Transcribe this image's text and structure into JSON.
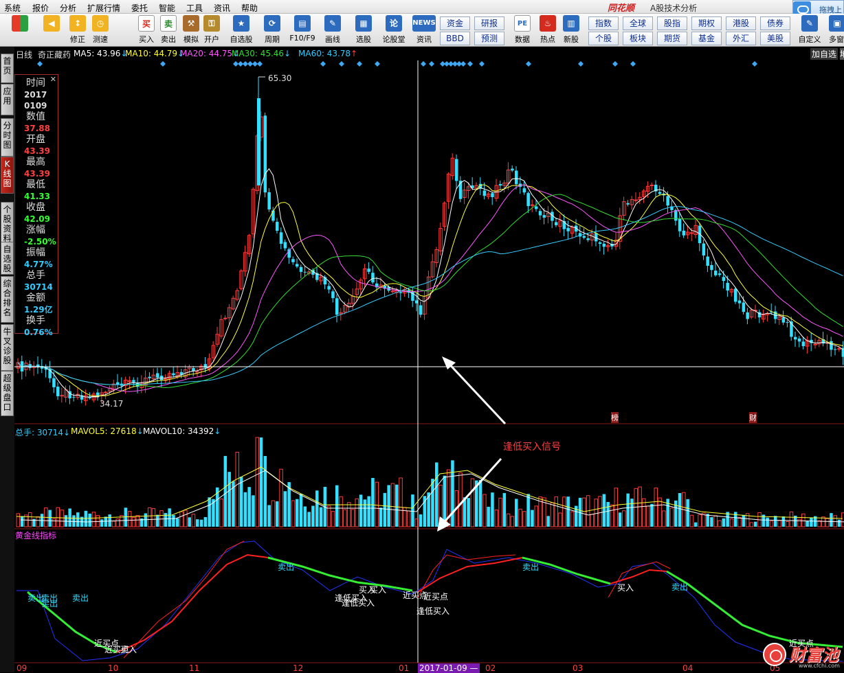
{
  "menu": [
    "系统",
    "报价",
    "分析",
    "扩展行情",
    "委托",
    "智能",
    "工具",
    "资讯",
    "帮助"
  ],
  "brand": {
    "logo": "同花顺",
    "sub": "A股技术分析",
    "drag": "拖拽上"
  },
  "toolbar": {
    "items": [
      {
        "label": "",
        "icon": "colored-squares-icon",
        "color": "#e43b2a"
      },
      {
        "label": "",
        "icon": "back-arrow-icon",
        "color": "#f1b321"
      },
      {
        "label": "修正",
        "icon": "up-down-arrow-icon",
        "color": "#f1b321"
      },
      {
        "label": "测速",
        "icon": "clock-icon",
        "color": "#f1b321"
      },
      {
        "label": "买入",
        "icon": "buy-icon",
        "color": "#d52a1e",
        "glyph": "买"
      },
      {
        "label": "卖出",
        "icon": "sell-icon",
        "color": "#2a8a2a",
        "glyph": "卖"
      },
      {
        "label": "模拟",
        "icon": "hammer-icon",
        "color": "#a86b2c"
      },
      {
        "label": "开户",
        "icon": "lock-icon",
        "color": "#b58a2c"
      },
      {
        "label": "自选股",
        "icon": "star-icon",
        "color": "#2d6bbf"
      },
      {
        "label": "周期",
        "icon": "cycle-icon",
        "color": "#2d6bbf"
      },
      {
        "label": "F10/F9",
        "icon": "f10-icon",
        "color": "#2d6bbf"
      },
      {
        "label": "画线",
        "icon": "pen-icon",
        "color": "#2d6bbf"
      },
      {
        "label": "选股",
        "icon": "screen-icon",
        "color": "#2d6bbf"
      },
      {
        "label": "论股堂",
        "icon": "forum-icon",
        "color": "#2d6bbf"
      },
      {
        "label": "资讯",
        "icon": "news-icon",
        "color": "#2d6bbf",
        "glyph": "NEWS"
      },
      {
        "label": "数据",
        "icon": "data-icon",
        "color": "#2d6bbf",
        "glyph": "PE"
      },
      {
        "label": "热点",
        "icon": "hot-icon",
        "color": "#d52a1e"
      },
      {
        "label": "新股",
        "icon": "new-stock-icon",
        "color": "#2d6bbf"
      },
      {
        "label": "自定义",
        "icon": "custom-icon",
        "color": "#2d6bbf"
      },
      {
        "label": "多窗",
        "icon": "multi-window-icon",
        "color": "#2d6bbf"
      }
    ],
    "grid": [
      "资金",
      "研报",
      "BBD",
      "预测",
      "指数",
      "全球",
      "股指",
      "期权",
      "港股",
      "债券",
      "个股",
      "板块",
      "期货",
      "基金",
      "外汇",
      "美股"
    ]
  },
  "sidebar": [
    "首页",
    "应用",
    "分时图",
    "K线图",
    "个股资料",
    "自选股",
    "综合排名",
    "牛叉诊股",
    "超级盘口"
  ],
  "header": {
    "period": "日线",
    "name": "奇正藏药",
    "ma": [
      {
        "t": "MA5: 43.96",
        "c": "#ffffff"
      },
      {
        "t": "MA10: 44.79",
        "c": "#ffff33"
      },
      {
        "t": "MA20: 44.75",
        "c": "#ff55ff"
      },
      {
        "t": "MA30: 45.46",
        "c": "#33dd33"
      },
      {
        "t": "MA60: 43.78",
        "c": "#33ccff"
      }
    ],
    "add": "加自选",
    "add2": "地"
  },
  "info": {
    "rows": [
      {
        "k": "时间",
        "v": "2017",
        "c": "#dddddd"
      },
      {
        "k": "",
        "v": "0109",
        "c": "#dddddd"
      },
      {
        "k": "数值",
        "v": "37.88",
        "c": "#ff4040"
      },
      {
        "k": "开盘",
        "v": "43.39",
        "c": "#ff4040"
      },
      {
        "k": "最高",
        "v": "43.39",
        "c": "#ff4040"
      },
      {
        "k": "最低",
        "v": "41.33",
        "c": "#33ff33"
      },
      {
        "k": "收盘",
        "v": "42.09",
        "c": "#33ff33"
      },
      {
        "k": "涨幅",
        "v": "-2.50%",
        "c": "#33ff33"
      },
      {
        "k": "振幅",
        "v": "4.77%",
        "c": "#33ccff"
      },
      {
        "k": "总手",
        "v": "30714",
        "c": "#33ccff"
      },
      {
        "k": "金额",
        "v": "1.29亿",
        "c": "#33ccff"
      },
      {
        "k": "换手",
        "v": "0.76%",
        "c": "#33ccff"
      }
    ]
  },
  "price_marks": {
    "high": "65.30",
    "low": "34.17",
    "tag1": "榜",
    "tag2": "财"
  },
  "vol_header": [
    {
      "t": "总手: 30714",
      "c": "#33ccff"
    },
    {
      "t": "MAVOL5: 27618",
      "c": "#ffff33"
    },
    {
      "t": "MAVOL10: 34392",
      "c": "#ffffff"
    }
  ],
  "annotation": "逢低买入信号",
  "indicator": {
    "title": "黄金线指标",
    "labels": [
      "卖出",
      "卖出",
      "卖出",
      "卖出",
      "近买点",
      "近买点",
      "买入",
      "卖出",
      "逢低买入",
      "逢低买入",
      "买入",
      "买入",
      "卖出",
      "卖出",
      "近买点",
      "逢低买入"
    ]
  },
  "xaxis": [
    "09",
    "10",
    "11",
    "12",
    "01",
    "2017-01-09 —",
    "02",
    "03",
    "04",
    "05"
  ],
  "watermark": {
    "name": "财富池",
    "url": "www.cfchi.com"
  },
  "chart_data": {
    "type": "candlestick",
    "title": "奇正藏药 日线",
    "price_high": 65.3,
    "price_low": 34.17,
    "selected": {
      "date": "2017-01-09",
      "open": 43.39,
      "high": 43.39,
      "low": 41.33,
      "close": 42.09,
      "change_pct": -2.5,
      "amplitude_pct": 4.77,
      "volume": 30714,
      "amount": "1.29亿",
      "turnover_pct": 0.76
    },
    "indicators": {
      "MA5": 43.96,
      "MA10": 44.79,
      "MA20": 44.75,
      "MA30": 45.46,
      "MA60": 43.78,
      "MAVOL5": 27618,
      "MAVOL10": 34392
    },
    "months": [
      "09",
      "10",
      "11",
      "12",
      "01",
      "02",
      "03",
      "04",
      "05"
    ]
  }
}
